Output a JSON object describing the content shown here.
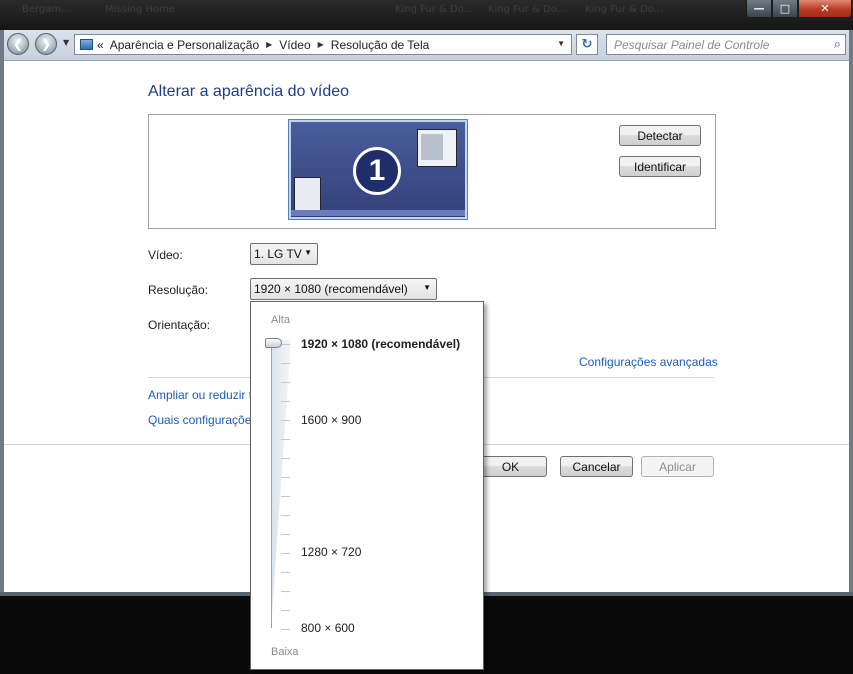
{
  "window": {
    "background_taskbar_items": [
      "Bergam...",
      "Missing Home",
      "King Fur & Do...",
      "King Fur & Do...",
      "King Fur & Do..."
    ],
    "controls": {
      "minimize": "—",
      "maximize": "□",
      "close": "✕"
    }
  },
  "nav": {
    "back_icon": "❮",
    "forward_icon": "❯",
    "overflow": "«",
    "breadcrumbs": [
      "Aparência e Personalização",
      "Vídeo",
      "Resolução de Tela"
    ],
    "refresh_icon": "↻",
    "search_placeholder": "Pesquisar Painel de Controle",
    "search_icon": "⌕"
  },
  "main": {
    "heading": "Alterar a aparência do vídeo",
    "monitor_number": "1",
    "detect_label": "Detectar",
    "identify_label": "Identificar",
    "video_label": "Vídeo:",
    "video_value": "1. LG TV",
    "resolution_label": "Resolução:",
    "resolution_value": "1920 × 1080 (recomendável)",
    "orientation_label": "Orientação:",
    "advanced_link": "Configurações avançadas",
    "link_enlarge": "Ampliar ou reduzir t",
    "link_which": "Quais configuraçõe",
    "ok_label": "OK",
    "cancel_label": "Cancelar",
    "apply_label": "Aplicar"
  },
  "resolution_popup": {
    "high_label": "Alta",
    "low_label": "Baixa",
    "options": [
      {
        "label": "1920 × 1080 (recomendável)",
        "selected": true
      },
      {
        "label": "1600 × 900",
        "selected": false
      },
      {
        "label": "1280 × 720",
        "selected": false
      },
      {
        "label": "800 × 600",
        "selected": false
      }
    ]
  }
}
